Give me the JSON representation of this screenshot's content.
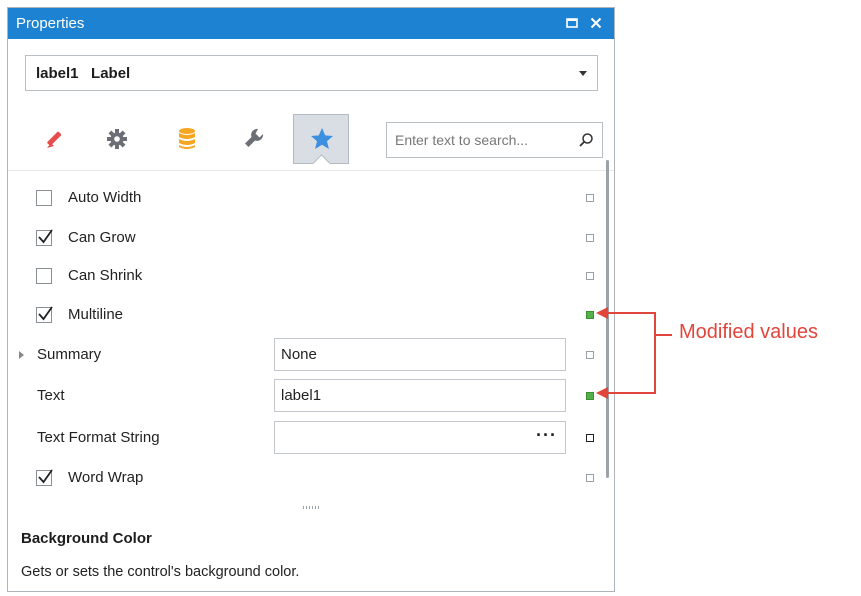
{
  "window": {
    "title": "Properties"
  },
  "selector": {
    "value": "label1   Label"
  },
  "tabs": [
    {
      "name": "appearance-tab",
      "icon": "paint-brush-icon"
    },
    {
      "name": "behavior-tab",
      "icon": "gear-icon"
    },
    {
      "name": "data-tab",
      "icon": "database-icon"
    },
    {
      "name": "design-tab",
      "icon": "wrench-icon"
    },
    {
      "name": "favorites-tab",
      "icon": "star-icon",
      "active": true
    }
  ],
  "search": {
    "placeholder": "Enter text to search..."
  },
  "properties": {
    "auto_width": {
      "label": "Auto Width",
      "checked": false,
      "modified": false
    },
    "can_grow": {
      "label": "Can Grow",
      "checked": true,
      "modified": false
    },
    "can_shrink": {
      "label": "Can Shrink",
      "checked": false,
      "modified": false
    },
    "multiline": {
      "label": "Multiline",
      "checked": true,
      "modified": true
    },
    "summary": {
      "label": "Summary",
      "value": "None",
      "modified": false
    },
    "text": {
      "label": "Text",
      "value": "label1",
      "modified": true
    },
    "text_format_string": {
      "label": "Text Format String",
      "value": "",
      "ellipsis": "···",
      "modified": false
    },
    "word_wrap": {
      "label": "Word Wrap",
      "checked": true,
      "modified": false
    }
  },
  "description": {
    "title": "Background Color",
    "text": "Gets or sets the control's background color."
  },
  "callout": {
    "text": "Modified values"
  },
  "colors": {
    "titlebar": "#1e82d2",
    "modified_indicator": "#54b04a",
    "callout": "#e0463c",
    "active_icon": "#3d8fe0"
  }
}
